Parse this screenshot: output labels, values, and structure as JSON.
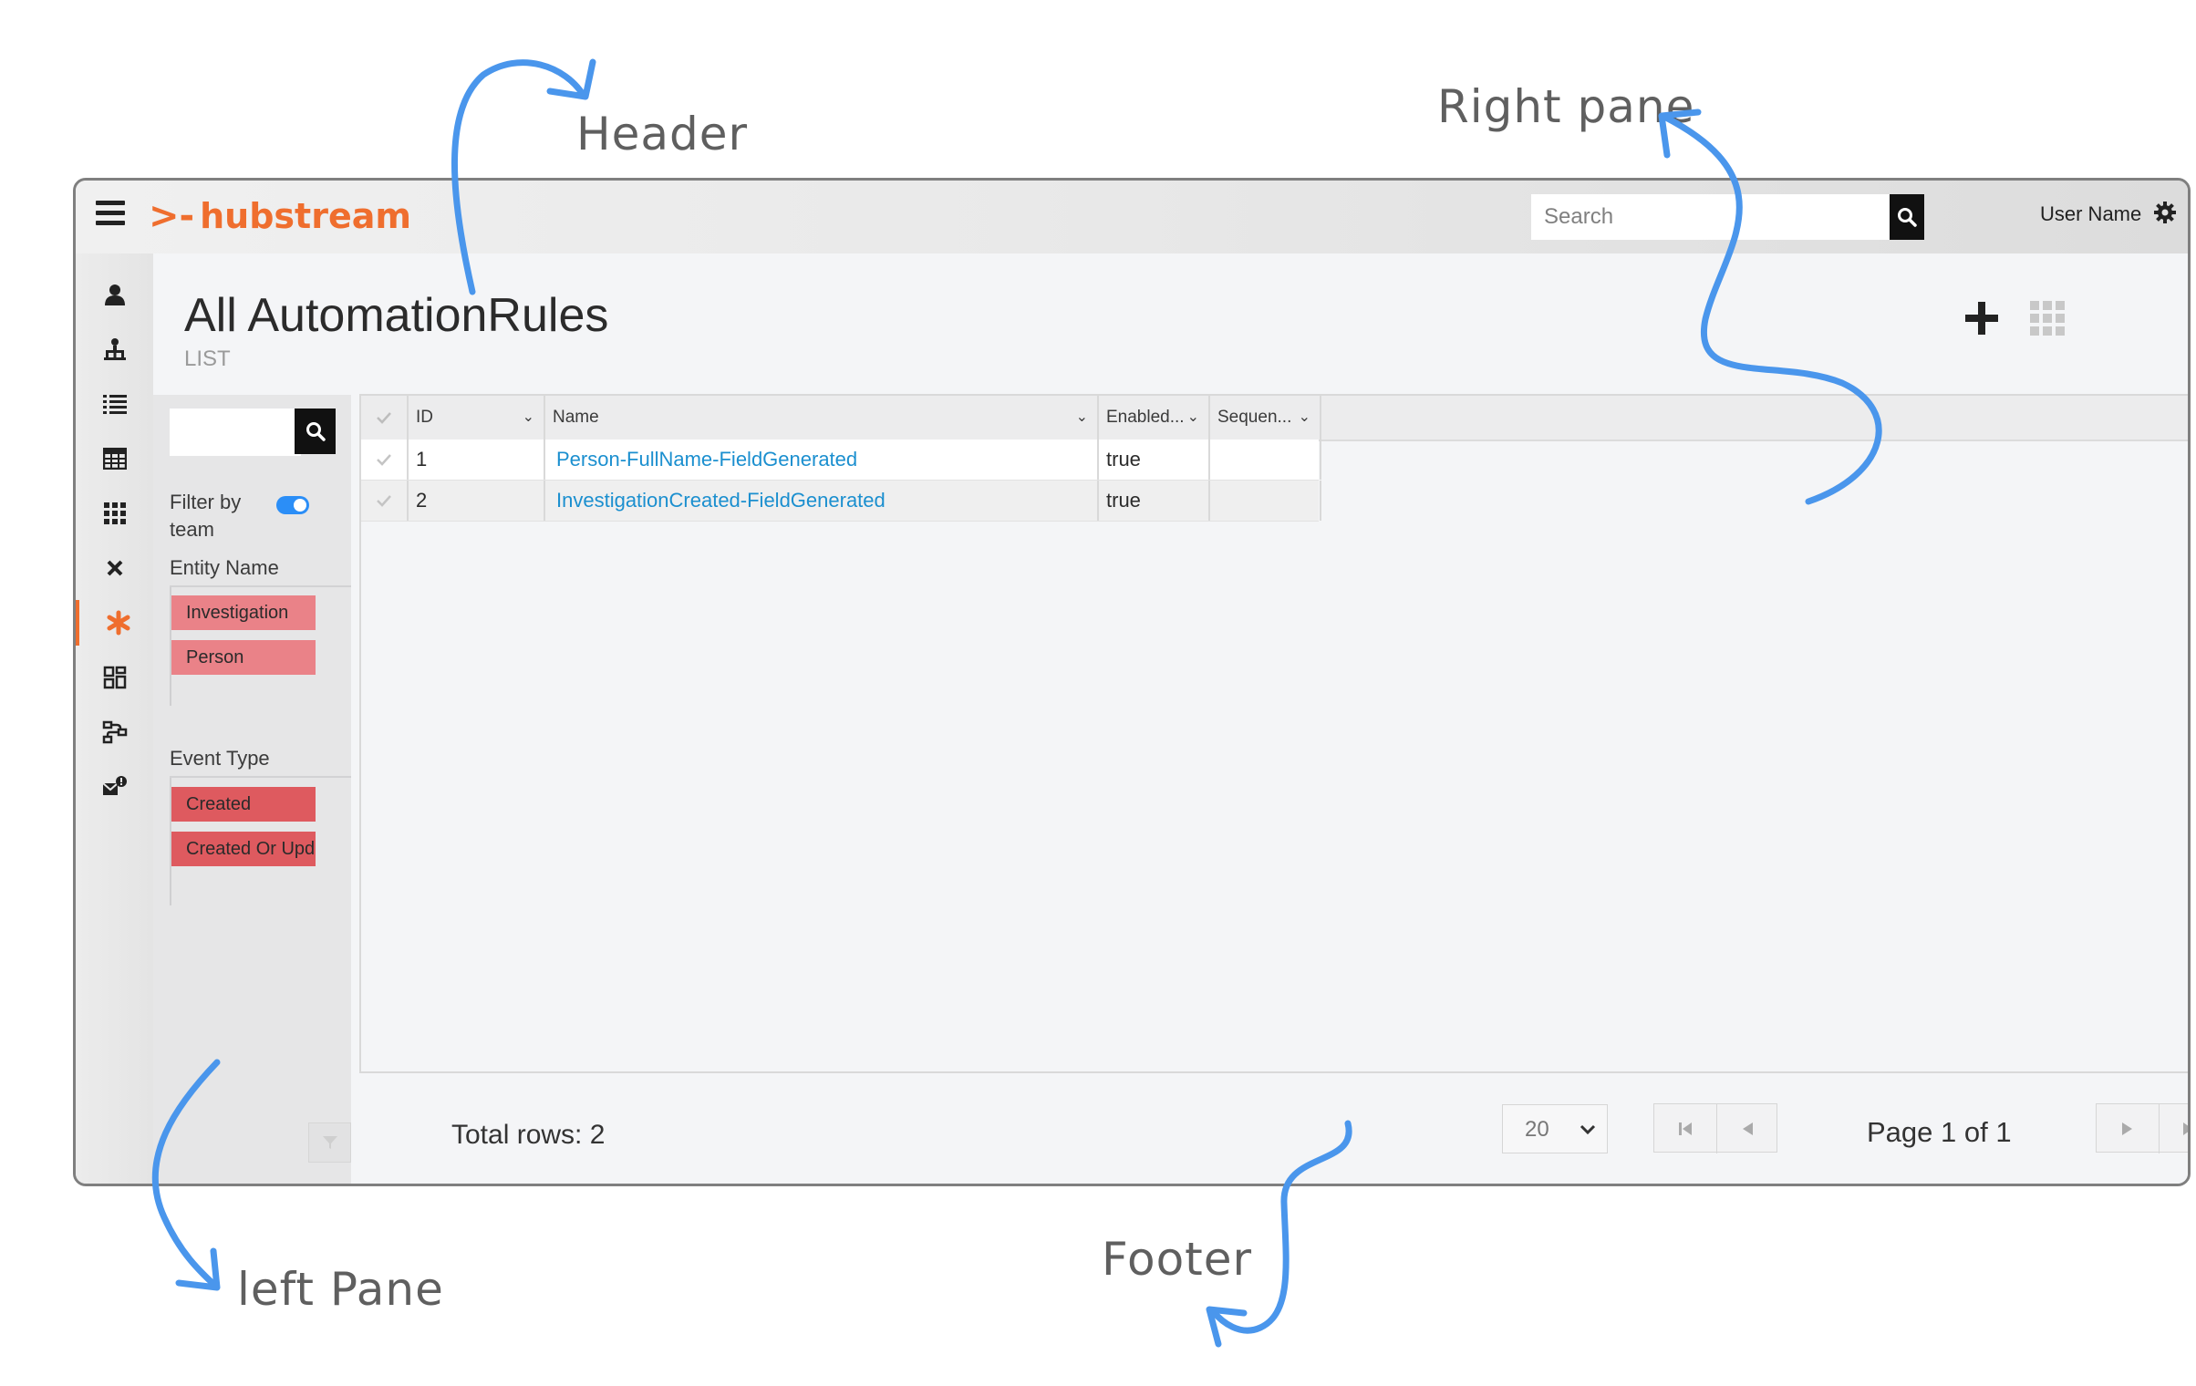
{
  "annotations": {
    "header": "Header",
    "right_pane": "Right pane",
    "left_pane": "left Pane",
    "footer": "Footer"
  },
  "app": {
    "brand": "hubstream",
    "brand_color": "#ef6e2e",
    "search_placeholder": "Search",
    "user_name": "User Name"
  },
  "rail": {
    "icons": [
      "person-icon",
      "org-chart-icon",
      "list-icon",
      "table-icon",
      "grid-icon",
      "close-icon",
      "asterisk-icon",
      "dashboard-icon",
      "workflow-icon",
      "mail-alert-icon"
    ],
    "active": "asterisk-icon"
  },
  "page": {
    "title": "All AutomationRules",
    "subtitle": "LIST"
  },
  "filters": {
    "filter_by_team": "Filter by team",
    "filter_by_team_on": true,
    "entity_name_label": "Entity Name",
    "entity_names": [
      "Investigation",
      "Person"
    ],
    "event_type_label": "Event Type",
    "event_types": [
      "Created",
      "Created Or Updated"
    ]
  },
  "table": {
    "columns": [
      "ID",
      "Name",
      "Enabled...",
      "Sequen..."
    ],
    "rows": [
      {
        "id": "1",
        "name": "Person-FullName-FieldGenerated",
        "enabled": "true",
        "sequence": ""
      },
      {
        "id": "2",
        "name": "InvestigationCreated-FieldGenerated",
        "enabled": "true",
        "sequence": ""
      }
    ]
  },
  "footer": {
    "total_rows": "Total rows: 2",
    "page_size": "20",
    "page_info": "Page 1 of 1"
  },
  "colors": {
    "accent": "#ef6e2e",
    "link": "#1b8fcf",
    "annotation_arrow": "#4a96ec",
    "chip_entity": "#ea8288",
    "chip_event": "#de5a5f",
    "toggle_on": "#2b8ef7"
  }
}
